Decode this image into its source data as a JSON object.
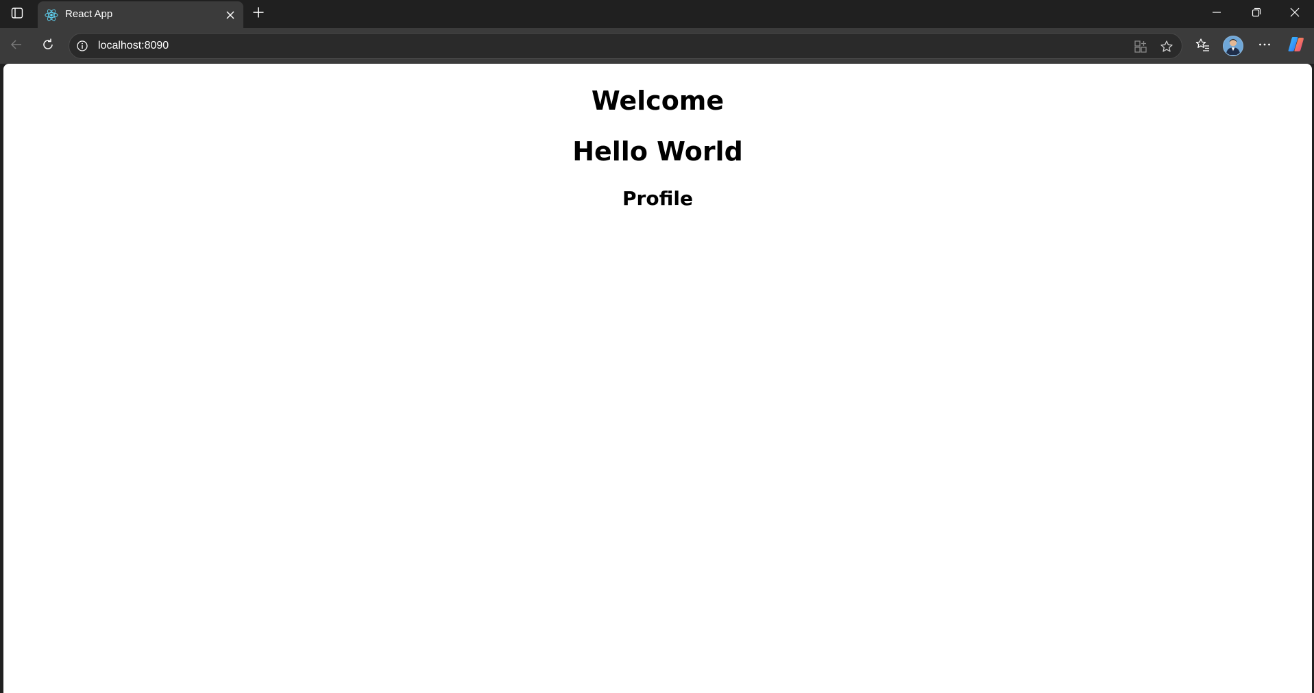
{
  "browser": {
    "tab": {
      "title": "React App",
      "favicon": "react-atom-icon"
    },
    "address": {
      "url": "localhost:8090"
    },
    "icons": {
      "tab_actions": "tab-actions-icon",
      "close": "close-icon",
      "new_tab": "plus-icon",
      "minimize": "minimize-icon",
      "restore": "restore-icon",
      "window_close": "close-icon",
      "back": "arrow-left-icon",
      "refresh": "refresh-icon",
      "site_info": "info-icon",
      "apps": "apps-icon",
      "favorite": "star-icon",
      "favorites": "favorites-list-icon",
      "more": "more-dots-icon",
      "copilot": "copilot-icon"
    },
    "colors": {
      "frame": "#202020",
      "toolbar": "#3b3b3b",
      "react_accent": "#61dafb"
    }
  },
  "page": {
    "heading_welcome": "Welcome",
    "heading_hello": "Hello World",
    "heading_profile": "Profile"
  }
}
